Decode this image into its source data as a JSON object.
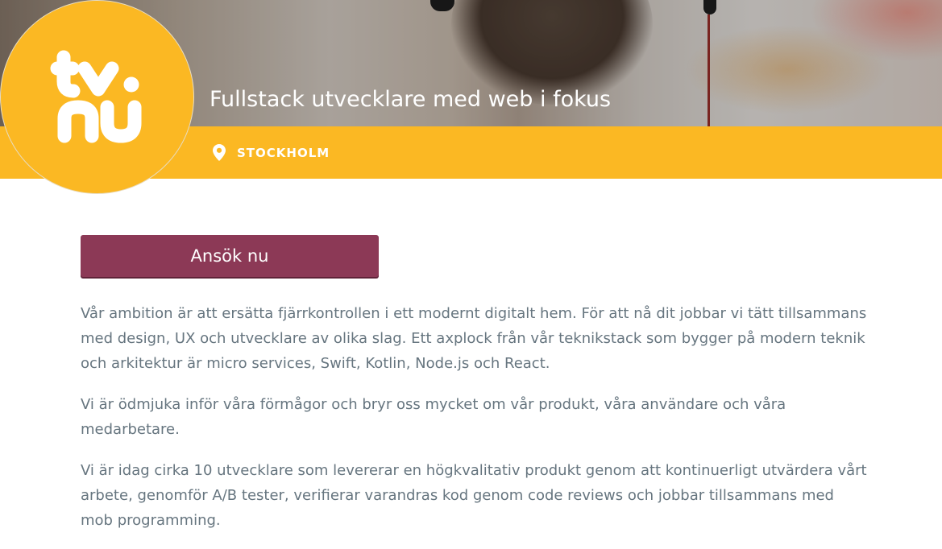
{
  "header": {
    "logo_alt": "tv.nu",
    "title": "Fullstack utvecklare med web i fokus",
    "location": "STOCKHOLM",
    "location_icon": "map-pin-icon"
  },
  "apply_button": {
    "label": "Ansök nu"
  },
  "body": {
    "paragraphs": [
      "Vår ambition är att ersätta fjärrkontrollen i ett modernt digitalt hem. För att nå dit jobbar vi tätt tillsammans med design, UX och utvecklare av olika slag. Ett axplock från vår teknikstack som bygger på modern teknik och arkitektur är micro services, Swift, Kotlin, Node.js och React.",
      "Vi är ödmjuka inför våra förmågor och bryr oss mycket om vår produkt, våra användare och våra medarbetare.",
      "Vi är idag cirka 10 utvecklare som levererar en högkvalitativ produkt genom att kontinuerligt utvärdera vårt arbete, genomför A/B tester, verifierar varandras kod genom code reviews och jobbar tillsammans med mob programming."
    ]
  },
  "colors": {
    "brand_yellow": "#fbb823",
    "button_purple": "#8c3956",
    "text_gray": "#66757f"
  }
}
